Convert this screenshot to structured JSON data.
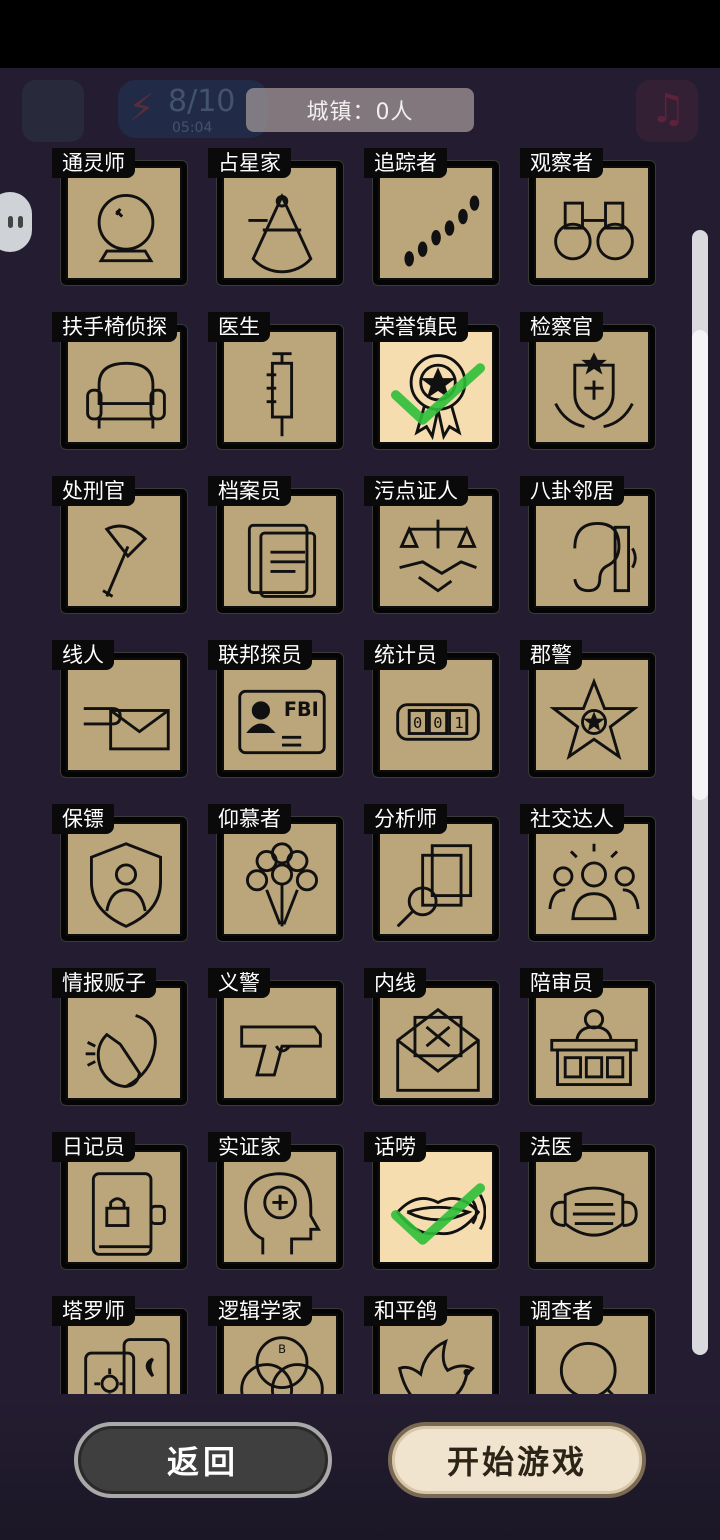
{
  "header": {
    "town_count": "城镇：0人",
    "energy": "8/10",
    "energy_timer": "05:04"
  },
  "roles": [
    {
      "label": "通灵师",
      "icon": "crystal-ball-icon",
      "selected": false
    },
    {
      "label": "占星家",
      "icon": "sextant-icon",
      "selected": false
    },
    {
      "label": "追踪者",
      "icon": "footprints-icon",
      "selected": false
    },
    {
      "label": "观察者",
      "icon": "binoculars-icon",
      "selected": false
    },
    {
      "label": "扶手椅侦探",
      "icon": "armchair-icon",
      "selected": false
    },
    {
      "label": "医生",
      "icon": "syringe-icon",
      "selected": false
    },
    {
      "label": "荣誉镇民",
      "icon": "medal-icon",
      "selected": true
    },
    {
      "label": "检察官",
      "icon": "prosecutor-badge-icon",
      "selected": false
    },
    {
      "label": "处刑官",
      "icon": "axe-icon",
      "selected": false
    },
    {
      "label": "档案员",
      "icon": "documents-icon",
      "selected": false
    },
    {
      "label": "污点证人",
      "icon": "scales-handshake-icon",
      "selected": false
    },
    {
      "label": "八卦邻居",
      "icon": "ear-icon",
      "selected": false
    },
    {
      "label": "线人",
      "icon": "envelope-hand-icon",
      "selected": false
    },
    {
      "label": "联邦探员",
      "icon": "fbi-id-icon",
      "selected": false
    },
    {
      "label": "统计员",
      "icon": "counter-icon",
      "selected": false
    },
    {
      "label": "郡警",
      "icon": "sheriff-star-icon",
      "selected": false
    },
    {
      "label": "保镖",
      "icon": "bodyguard-shield-icon",
      "selected": false
    },
    {
      "label": "仰慕者",
      "icon": "roses-icon",
      "selected": false
    },
    {
      "label": "分析师",
      "icon": "analysis-icon",
      "selected": false
    },
    {
      "label": "社交达人",
      "icon": "crowd-icon",
      "selected": false
    },
    {
      "label": "情报贩子",
      "icon": "whisper-icon",
      "selected": false
    },
    {
      "label": "义警",
      "icon": "pistol-icon",
      "selected": false
    },
    {
      "label": "内线",
      "icon": "x-letter-icon",
      "selected": false
    },
    {
      "label": "陪审员",
      "icon": "jury-box-icon",
      "selected": false
    },
    {
      "label": "日记员",
      "icon": "locked-diary-icon",
      "selected": false
    },
    {
      "label": "实证家",
      "icon": "head-plus-icon",
      "selected": false
    },
    {
      "label": "话唠",
      "icon": "talking-mouth-icon",
      "selected": true
    },
    {
      "label": "法医",
      "icon": "face-mask-icon",
      "selected": false
    },
    {
      "label": "塔罗师",
      "icon": "tarot-cards-icon",
      "selected": false
    },
    {
      "label": "逻辑学家",
      "icon": "venn-diagram-icon",
      "selected": false
    },
    {
      "label": "和平鸽",
      "icon": "dove-icon",
      "selected": false
    },
    {
      "label": "调查者",
      "icon": "magnifier-icon",
      "selected": false
    }
  ],
  "buttons": {
    "back": "返回",
    "start": "开始游戏"
  },
  "colors": {
    "tile": "#bba57a",
    "tile_selected": "#f6ddb0",
    "check": "#2fbf3a"
  }
}
